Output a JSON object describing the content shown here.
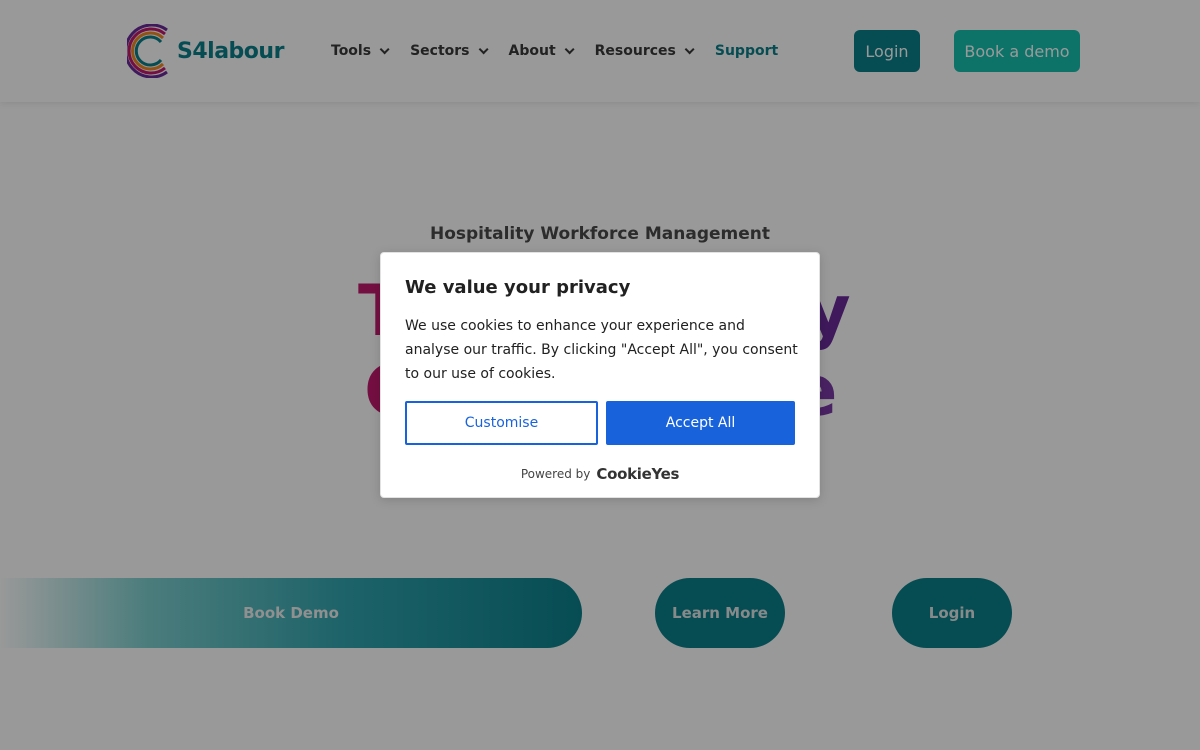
{
  "header": {
    "logo_text": "S4labour",
    "nav": [
      {
        "label": "Tools",
        "has_dropdown": true
      },
      {
        "label": "Sectors",
        "has_dropdown": true
      },
      {
        "label": "About",
        "has_dropdown": true
      },
      {
        "label": "Resources",
        "has_dropdown": true
      },
      {
        "label": "Support",
        "has_dropdown": false
      }
    ],
    "login_label": "Login",
    "book_demo_label": "Book a demo"
  },
  "hero": {
    "eyebrow": "Hospitality Workforce Management",
    "line1_left": "T",
    "line1_right": "y",
    "line2_left": "C",
    "line2_right": "e"
  },
  "cta": {
    "book_demo": "Book Demo",
    "learn_more": "Learn More",
    "login": "Login"
  },
  "cookie": {
    "title": "We value your privacy",
    "body": "We use cookies to enhance your experience and analyse our traffic. By clicking \"Accept All\", you consent to our use of cookies.",
    "customise_label": "Customise",
    "accept_label": "Accept All",
    "powered_by": "Powered by",
    "brand": "CookieYes"
  },
  "colors": {
    "brand_teal": "#0b7f8a",
    "brand_aqua": "#16c0b0",
    "cookie_blue": "#1863dc",
    "hero_magenta": "#c21a6e",
    "hero_purple": "#6a2a9a"
  }
}
